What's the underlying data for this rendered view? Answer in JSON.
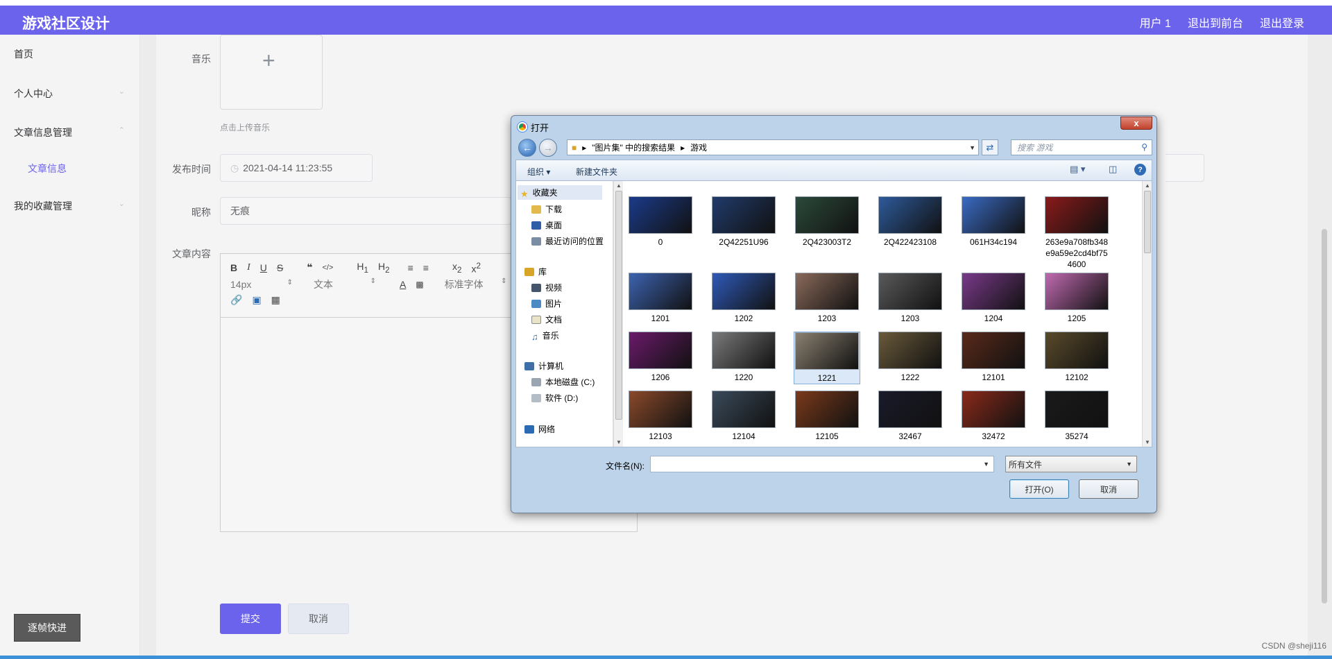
{
  "header": {
    "title": "游戏社区设计",
    "nav": [
      "用户 1",
      "退出到前台",
      "退出登录"
    ]
  },
  "sidebar": {
    "items": [
      {
        "label": "首页"
      },
      {
        "label": "个人中心"
      },
      {
        "label": "文章信息管理"
      },
      {
        "label": "文章信息"
      },
      {
        "label": "我的收藏管理"
      }
    ],
    "step_button": "逐帧快进"
  },
  "form": {
    "music_label": "音乐",
    "music_hint": "点击上传音乐",
    "publish_time_label": "发布时间",
    "publish_time_value": "2021-04-14 11:23:55",
    "nickname_label": "昵称",
    "nickname_value": "无痕",
    "content_label": "文章内容",
    "editor": {
      "font_size": "14px",
      "text_type": "文本",
      "font_family": "标准字体"
    },
    "submit_label": "提交",
    "cancel_label": "取消"
  },
  "dialog": {
    "title": "打开",
    "close": "x",
    "breadcrumb": [
      "\"图片集\" 中的搜索结果",
      "游戏"
    ],
    "search_placeholder": "搜索 游戏",
    "organize_label": "组织 ▾",
    "new_folder_label": "新建文件夹",
    "nav_pane": {
      "favorites": "收藏夹",
      "downloads": "下载",
      "desktop": "桌面",
      "recent": "最近访问的位置",
      "libraries": "库",
      "videos": "视频",
      "pictures": "图片",
      "documents": "文档",
      "music": "音乐",
      "computer": "计算机",
      "local_disk": "本地磁盘 (C:)",
      "software_disk": "软件 (D:)",
      "network": "网络"
    },
    "files": [
      {
        "name": "0",
        "color": "#1b3b8a"
      },
      {
        "name": "2Q42251U96",
        "color": "#213b6b"
      },
      {
        "name": "2Q423003T2",
        "color": "#2b4a3a"
      },
      {
        "name": "2Q422423108",
        "color": "#2d5a9a"
      },
      {
        "name": "061H34c194",
        "color": "#3a6bc4"
      },
      {
        "name": "263e9a708fb348e9a59e2cd4bf754600",
        "color": "#8a1a1a"
      },
      {
        "name": "1201",
        "color": "#3d63b0"
      },
      {
        "name": "1202",
        "color": "#2f5ab8"
      },
      {
        "name": "1203",
        "color": "#8a6a5a"
      },
      {
        "name": "1203",
        "color": "#5a5a5a"
      },
      {
        "name": "1204",
        "color": "#7a3a8a"
      },
      {
        "name": "1205",
        "color": "#c06ab0"
      },
      {
        "name": "1206",
        "color": "#6a1a6a"
      },
      {
        "name": "1220",
        "color": "#7a7a7a"
      },
      {
        "name": "1221",
        "color": "#8a8070"
      },
      {
        "name": "1222",
        "color": "#6a5a3a"
      },
      {
        "name": "12101",
        "color": "#5a2a1a"
      },
      {
        "name": "12102",
        "color": "#5a4a2a"
      },
      {
        "name": "12103",
        "color": "#8a4a2a"
      },
      {
        "name": "12104",
        "color": "#3a4a5a"
      },
      {
        "name": "12105",
        "color": "#7a3a1a"
      },
      {
        "name": "32467",
        "color": "#1a1a2a"
      },
      {
        "name": "32472",
        "color": "#8a2a1a"
      },
      {
        "name": "35274",
        "color": "#1a1a1a"
      }
    ],
    "selected_file": "1221",
    "filename_label": "文件名(N):",
    "filename_value": "",
    "filetype_value": "所有文件",
    "open_label": "打开(O)",
    "cancel_label": "取消"
  },
  "watermark": "CSDN @sheji116"
}
